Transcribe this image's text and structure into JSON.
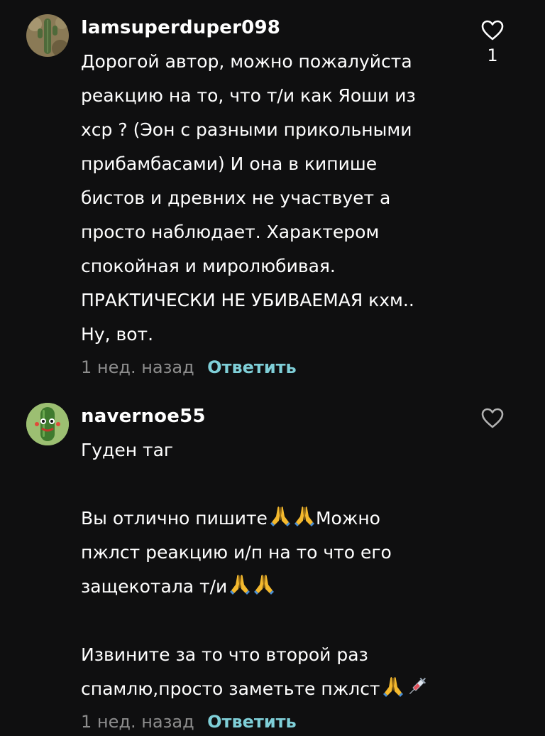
{
  "comments": [
    {
      "username": "Iamsuperduper098",
      "lines": [
        "Дорогой автор, можно пожалуйста",
        "реакцию на то, что т/и как Яоши из",
        "хср ? (Эон с разными прикольными",
        "прибамбасами) И она в кипише",
        "бистов и древних не участвует а",
        "просто наблюдает. Характером",
        "спокойная и миролюбивая.",
        "ПРАКТИЧЕСКИ НЕ УБИВАЕМАЯ кхм..",
        "Ну, вот."
      ],
      "time": "1 нед. назад",
      "reply_label": "Ответить",
      "like_count": "1",
      "avatar_icon": "cactus-avatar"
    },
    {
      "username": "navernoe55",
      "lines": [
        "Гуден таг",
        "",
        "Вы отлично пишите",
        "Можно",
        "пжлст реакцию и/п на то что его",
        "защекотала т/и",
        "",
        "Извините за то что второй раз",
        "спамлю,просто заметьте пжлст"
      ],
      "time": "1 нед. назад",
      "reply_label": "Ответить",
      "like_count": "",
      "avatar_icon": "cucumber-avatar",
      "emojis": [
        "praying-hands",
        "praying-hands",
        "praying-hands",
        "praying-hands",
        "praying-hands",
        "syringe"
      ]
    }
  ],
  "colors": {
    "background": "#0f0f10",
    "text": "#ffffff",
    "muted": "#8d8d8d",
    "accent": "#7fcfd8"
  }
}
